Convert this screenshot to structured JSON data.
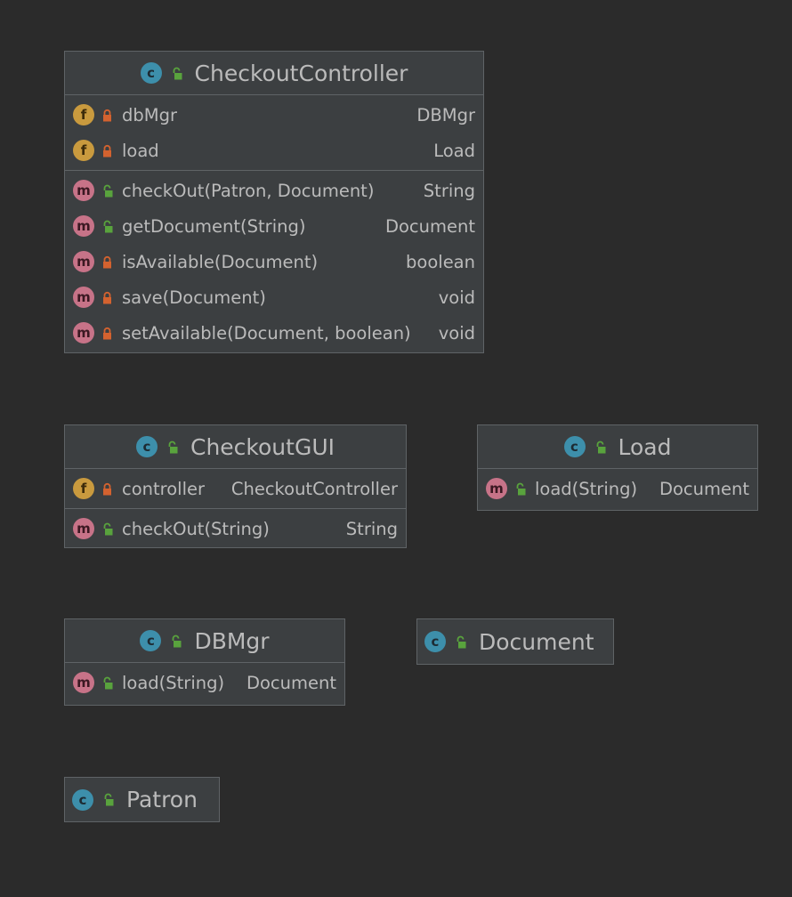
{
  "colors": {
    "background": "#2b2b2b",
    "box_fill": "#3c3f41",
    "box_border": "#5f6366",
    "text": "#bbbbbb",
    "class_badge": "#3d8fab",
    "field_badge": "#c99a3e",
    "method_badge": "#c77388",
    "public_lock": "#59a33d",
    "private_lock": "#d3622f"
  },
  "classes": {
    "checkout_controller": {
      "name": "CheckoutController",
      "badge": "c",
      "visibility": "public",
      "fields": [
        {
          "badge": "f",
          "visibility": "private",
          "name": "dbMgr",
          "type": "DBMgr"
        },
        {
          "badge": "f",
          "visibility": "private",
          "name": "load",
          "type": "Load"
        }
      ],
      "methods": [
        {
          "badge": "m",
          "visibility": "public",
          "name": "checkOut(Patron, Document)",
          "type": "String"
        },
        {
          "badge": "m",
          "visibility": "public",
          "name": "getDocument(String)",
          "type": "Document"
        },
        {
          "badge": "m",
          "visibility": "private",
          "name": "isAvailable(Document)",
          "type": "boolean"
        },
        {
          "badge": "m",
          "visibility": "private",
          "name": "save(Document)",
          "type": "void"
        },
        {
          "badge": "m",
          "visibility": "private",
          "name": "setAvailable(Document, boolean)",
          "type": "void"
        }
      ]
    },
    "checkout_gui": {
      "name": "CheckoutGUI",
      "badge": "c",
      "visibility": "public",
      "fields": [
        {
          "badge": "f",
          "visibility": "private",
          "name": "controller",
          "type": "CheckoutController"
        }
      ],
      "methods": [
        {
          "badge": "m",
          "visibility": "public",
          "name": "checkOut(String)",
          "type": "String"
        }
      ]
    },
    "load": {
      "name": "Load",
      "badge": "c",
      "visibility": "public",
      "fields": [],
      "methods": [
        {
          "badge": "m",
          "visibility": "public",
          "name": "load(String)",
          "type": "Document"
        }
      ]
    },
    "dbmgr": {
      "name": "DBMgr",
      "badge": "c",
      "visibility": "public",
      "fields": [],
      "methods": [
        {
          "badge": "m",
          "visibility": "public",
          "name": "load(String)",
          "type": "Document"
        }
      ]
    },
    "document": {
      "name": "Document",
      "badge": "c",
      "visibility": "public",
      "fields": [],
      "methods": []
    },
    "patron": {
      "name": "Patron",
      "badge": "c",
      "visibility": "public",
      "fields": [],
      "methods": []
    }
  }
}
